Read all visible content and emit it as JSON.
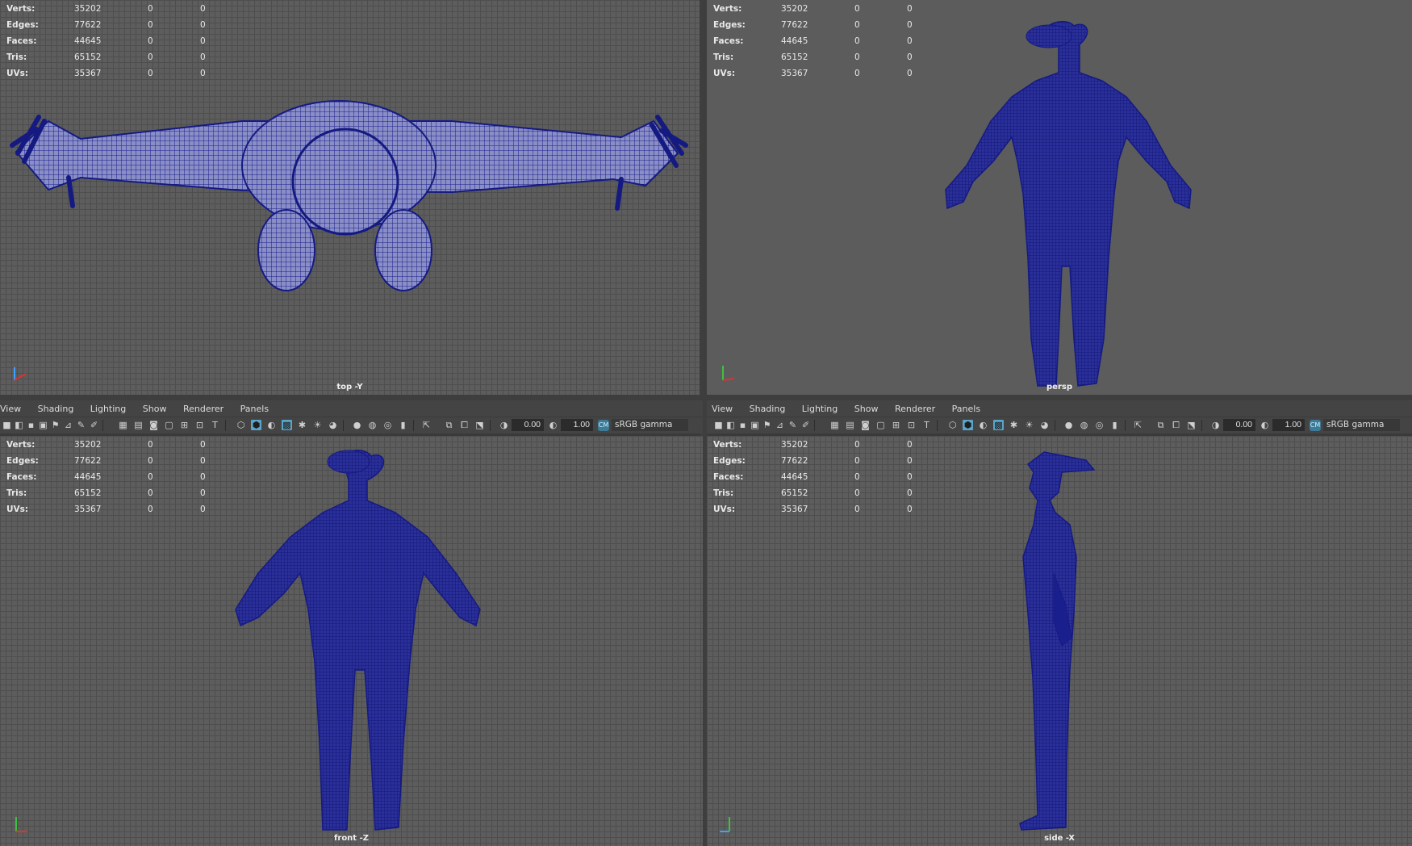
{
  "stats": {
    "rows": [
      {
        "key": "Verts:",
        "value": "35202",
        "a": "0",
        "b": "0"
      },
      {
        "key": "Edges:",
        "value": "77622",
        "a": "0",
        "b": "0"
      },
      {
        "key": "Faces:",
        "value": "44645",
        "a": "0",
        "b": "0"
      },
      {
        "key": "Tris:",
        "value": "65152",
        "a": "0",
        "b": "0"
      },
      {
        "key": "UVs:",
        "value": "35367",
        "a": "0",
        "b": "0"
      }
    ]
  },
  "viewports": {
    "top": {
      "label": "top -Y"
    },
    "persp": {
      "label": "persp"
    },
    "front": {
      "label": "front -Z"
    },
    "side": {
      "label": "side -X"
    }
  },
  "menu": {
    "items": [
      "View",
      "Shading",
      "Lighting",
      "Show",
      "Renderer",
      "Panels"
    ]
  },
  "toolbar": {
    "exposure": "0.00",
    "gamma_value": "1.00",
    "color_space": "sRGB gamma",
    "gamma_icon": "CM"
  },
  "colors": {
    "mesh": "#151a82",
    "mesh_line": "#3540c8",
    "viewport_bg": "#5d5d5d",
    "active_icon": "#5aa4c8"
  },
  "icons": [
    "camera-icon",
    "grid-icon",
    "wireframe-icon",
    "shaded-icon",
    "textured-icon",
    "lights-icon",
    "xray-icon",
    "isolate-icon",
    "color-management-icon"
  ]
}
